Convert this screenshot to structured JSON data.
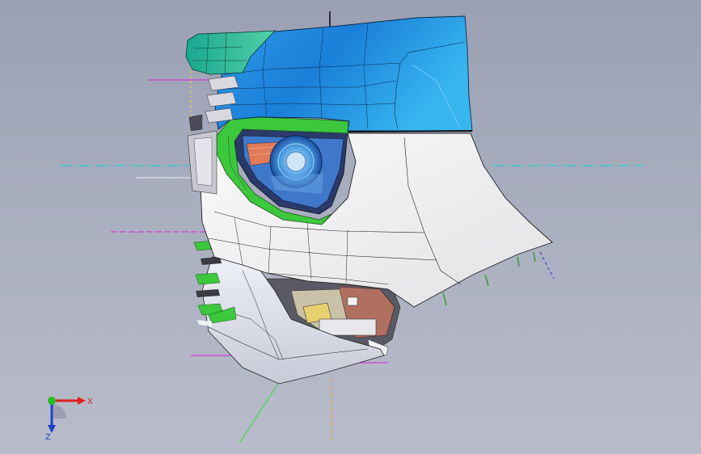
{
  "viewport": {
    "background_top": "#9aa0b2",
    "background_bottom": "#b8bcca"
  },
  "model": {
    "upper_panel_color": "#1e88e0",
    "upper_panel_highlight": "#4fc3f7",
    "teal_section_color": "#2bb3a0",
    "green_trim_color": "#3cc83c",
    "body_panel_color": "#f2f2f2",
    "lower_panel_color": "#e6e6ee",
    "interior_color": "#b07060",
    "lamp_glass_color": "#58a8e8"
  },
  "reference_lines": {
    "cyan": "#00d8d8",
    "magenta": "#e020e0",
    "green": "#30e030",
    "orange": "#f0a030",
    "yellow": "#e8e040"
  },
  "triad": {
    "x_label": "X",
    "z_label": "Z",
    "x_color": "#e02020",
    "z_color": "#2040d0",
    "origin_color": "#20c020",
    "icons": [
      "triad-x-arrow-icon",
      "triad-z-arrow-icon",
      "triad-origin-icon"
    ]
  }
}
